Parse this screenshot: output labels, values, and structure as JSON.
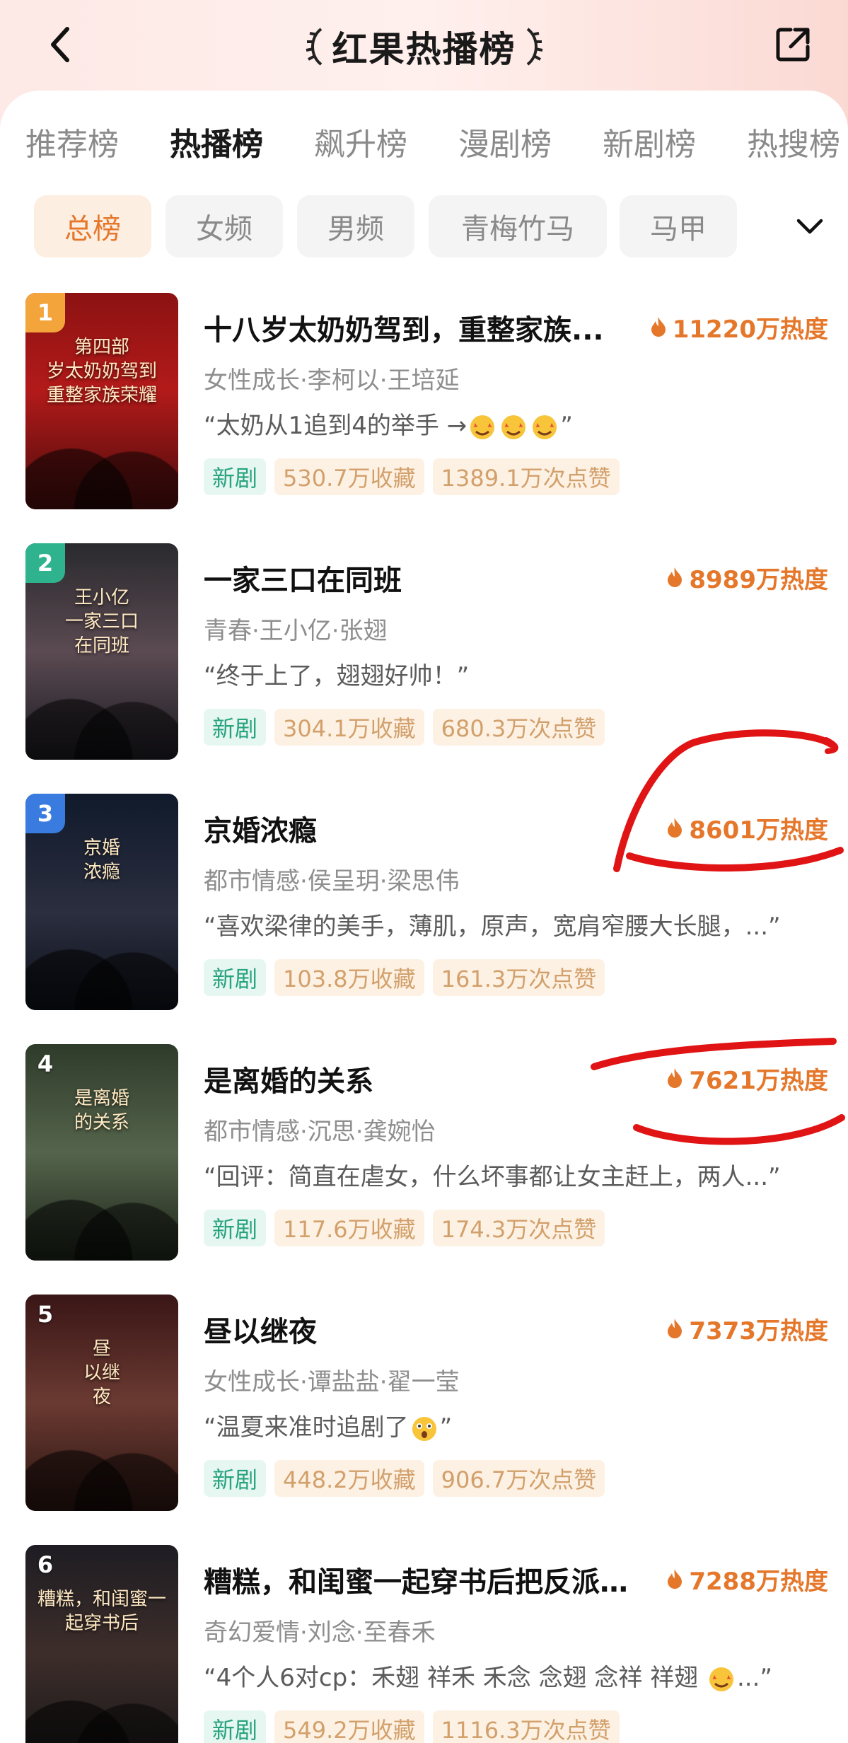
{
  "header": {
    "title": "红果热播榜",
    "back_icon": "chevron-left-icon",
    "share_icon": "share-icon"
  },
  "tabs": [
    {
      "label": "推荐榜",
      "active": false
    },
    {
      "label": "热播榜",
      "active": true
    },
    {
      "label": "飙升榜",
      "active": false
    },
    {
      "label": "漫剧榜",
      "active": false
    },
    {
      "label": "新剧榜",
      "active": false
    },
    {
      "label": "热搜榜",
      "active": false
    }
  ],
  "filters": [
    {
      "label": "总榜",
      "active": true
    },
    {
      "label": "女频",
      "active": false
    },
    {
      "label": "男频",
      "active": false
    },
    {
      "label": "青梅竹马",
      "active": false
    },
    {
      "label": "马甲",
      "active": false
    }
  ],
  "filter_more_icon": "chevron-down-icon",
  "items": [
    {
      "rank": "1",
      "title": "十八岁太奶奶驾到，重整家族...",
      "heat": "11220万热度",
      "meta": "女性成长·李柯以·王培延",
      "quote_prefix": "“太奶从1追到4的举手 →",
      "quote_suffix": "”",
      "quote_emojis": [
        "star-struck-emoji",
        "star-struck-emoji",
        "star-struck-emoji"
      ],
      "tag_new": "新剧",
      "favorites": "530.7万收藏",
      "likes": "1389.1万次点赞",
      "poster_text_1": "第四部",
      "poster_text_2": "岁太奶奶驾到",
      "poster_text_3": "重整家族荣耀"
    },
    {
      "rank": "2",
      "title": "一家三口在同班",
      "heat": "8989万热度",
      "meta": "青春·王小亿·张翅",
      "quote_prefix": "“终于上了，翅翅好帅！”",
      "quote_suffix": "",
      "quote_emojis": [],
      "tag_new": "新剧",
      "favorites": "304.1万收藏",
      "likes": "680.3万次点赞",
      "poster_text_1": "王小亿",
      "poster_text_2": "一家三口",
      "poster_text_3": "在同班"
    },
    {
      "rank": "3",
      "title": "京婚浓瘾",
      "heat": "8601万热度",
      "meta": "都市情感·侯呈玥·梁思伟",
      "quote_prefix": "“喜欢梁律的美手，薄肌，原声，宽肩窄腰大长腿，...”",
      "quote_suffix": "",
      "quote_emojis": [],
      "tag_new": "新剧",
      "favorites": "103.8万收藏",
      "likes": "161.3万次点赞",
      "poster_text_1": "京婚",
      "poster_text_2": "浓瘾",
      "poster_text_3": ""
    },
    {
      "rank": "4",
      "title": "是离婚的关系",
      "heat": "7621万热度",
      "meta": "都市情感·沉思·龚婉怡",
      "quote_prefix": "“回评：简直在虐女，什么坏事都让女主赶上，两人...”",
      "quote_suffix": "",
      "quote_emojis": [],
      "tag_new": "新剧",
      "favorites": "117.6万收藏",
      "likes": "174.3万次点赞",
      "poster_text_1": "是离婚",
      "poster_text_2": "的关系",
      "poster_text_3": ""
    },
    {
      "rank": "5",
      "title": "昼以继夜",
      "heat": "7373万热度",
      "meta": "女性成长·谭盐盐·翟一莹",
      "quote_prefix": "“温夏来准时追剧了",
      "quote_suffix": "”",
      "quote_emojis": [
        "astonished-emoji"
      ],
      "tag_new": "新剧",
      "favorites": "448.2万收藏",
      "likes": "906.7万次点赞",
      "poster_text_1": "昼",
      "poster_text_2": "以继",
      "poster_text_3": "夜"
    },
    {
      "rank": "6",
      "title": "糟糕，和闺蜜一起穿书后把反派...",
      "heat": "7288万热度",
      "meta": "奇幻爱情·刘念·至春禾",
      "quote_prefix": "“4个人6对cp：禾翅 祥禾 禾念 念翅 念祥 祥翅 ",
      "quote_suffix": "...”",
      "quote_emojis": [
        "star-struck-emoji"
      ],
      "tag_new": "新剧",
      "favorites": "549.2万收藏",
      "likes": "1116.3万次点赞",
      "poster_text_1": "糟糕，和闺蜜一起穿书后",
      "poster_text_2": "",
      "poster_text_3": ""
    }
  ],
  "colors": {
    "accent": "#e5772b",
    "rank1": "#f3a43a",
    "rank2": "#2fb38e",
    "rank3": "#3a7be0",
    "annotation": "#e01414"
  }
}
